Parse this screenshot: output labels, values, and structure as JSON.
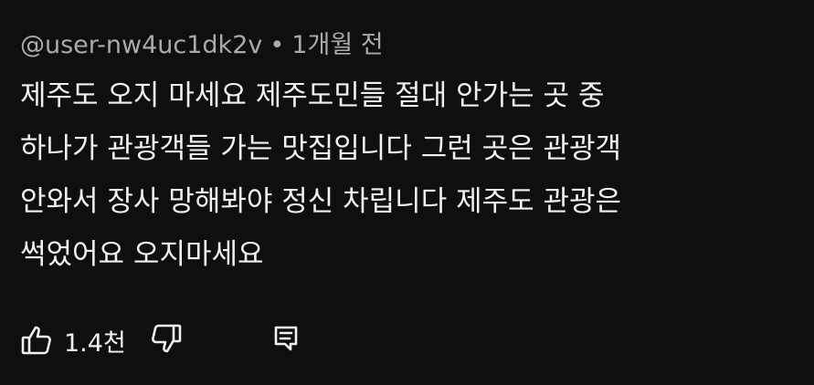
{
  "comment": {
    "author": "@user-nw4uc1dk2v",
    "separator": "•",
    "timestamp": "1개월 전",
    "text": "제주도 오지 마세요 제주도민들 절대 안가는 곳 중\n하나가 관광객들 가는 맛집입니다 그런 곳은 관광객\n안와서 장사 망해봐야 정신 차립니다 제주도 관광은\n썩었어요 오지마세요",
    "like_count": "1.4천"
  },
  "icons": {
    "like": "thumb-up-icon",
    "dislike": "thumb-down-icon",
    "reply": "comment-reply-icon"
  },
  "colors": {
    "background": "#0f0f0f",
    "text_primary": "#f1f1f1",
    "text_secondary": "#aaaaaa"
  }
}
